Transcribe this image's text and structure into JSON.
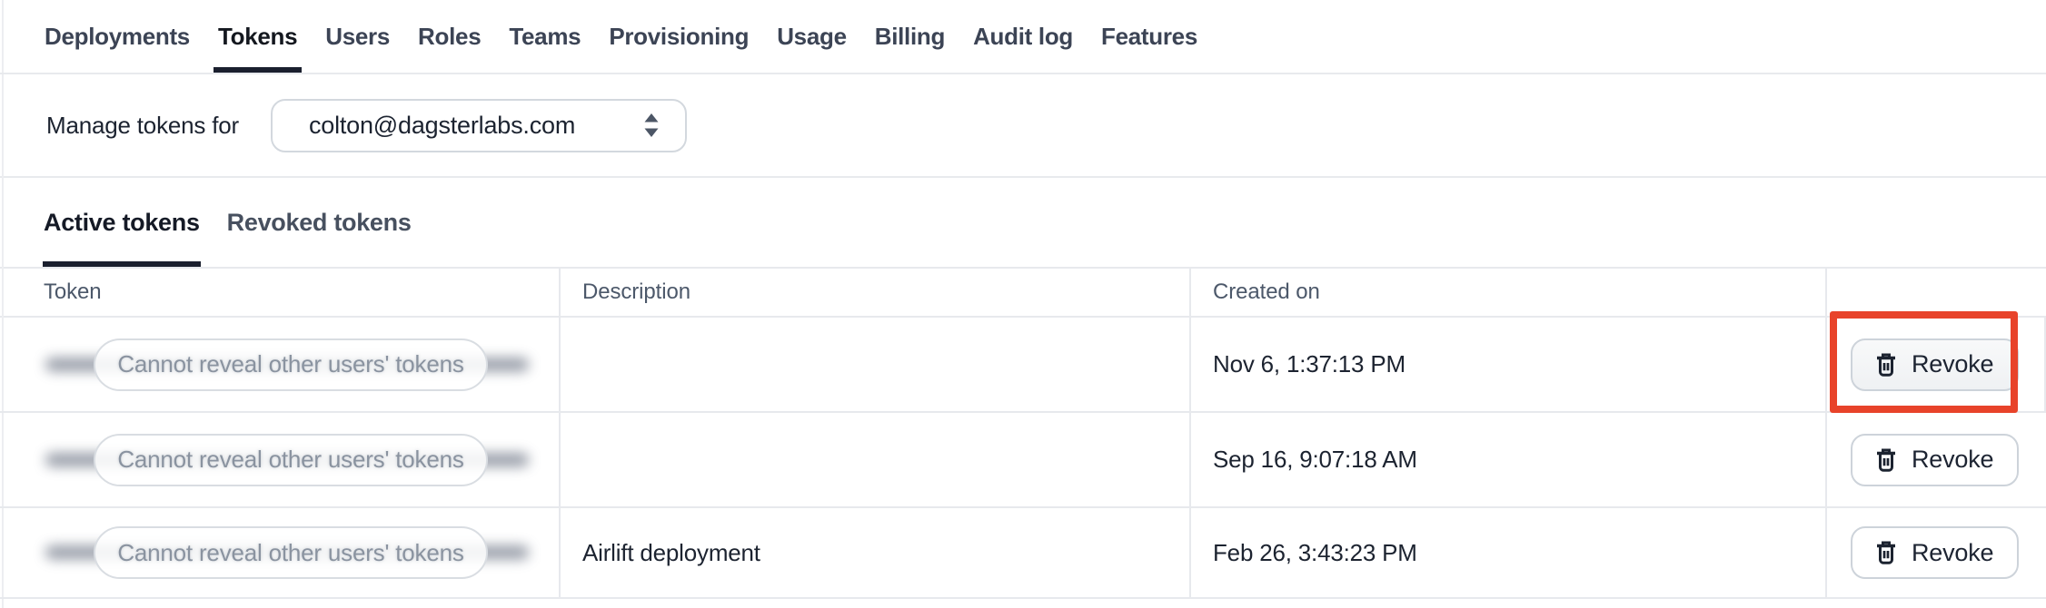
{
  "nav": {
    "tabs": [
      {
        "label": "Deployments",
        "selected": false
      },
      {
        "label": "Tokens",
        "selected": true
      },
      {
        "label": "Users",
        "selected": false
      },
      {
        "label": "Roles",
        "selected": false
      },
      {
        "label": "Teams",
        "selected": false
      },
      {
        "label": "Provisioning",
        "selected": false
      },
      {
        "label": "Usage",
        "selected": false
      },
      {
        "label": "Billing",
        "selected": false
      },
      {
        "label": "Audit log",
        "selected": false
      },
      {
        "label": "Features",
        "selected": false
      }
    ]
  },
  "manage": {
    "label": "Manage tokens for",
    "selected_user": "colton@dagsterlabs.com"
  },
  "token_tabs": {
    "active": "Active tokens",
    "revoked": "Revoked tokens"
  },
  "table": {
    "headers": {
      "token": "Token",
      "description": "Description",
      "created_on": "Created on"
    },
    "rows": [
      {
        "token_overlay": "Cannot reveal other users' tokens",
        "description": "",
        "created_on": "Nov 6, 1:37:13 PM",
        "action_label": "Revoke",
        "annotated": true
      },
      {
        "token_overlay": "Cannot reveal other users' tokens",
        "description": "",
        "created_on": "Sep 16, 9:07:18 AM",
        "action_label": "Revoke",
        "annotated": false
      },
      {
        "token_overlay": "Cannot reveal other users' tokens",
        "description": "Airlift deployment",
        "created_on": "Feb 26, 3:43:23 PM",
        "action_label": "Revoke",
        "annotated": false
      }
    ]
  },
  "icons": {
    "revoke_button": "trash-icon",
    "user_select": "double-caret-vertical-icon"
  },
  "colors": {
    "annotation_box": "#E8432A",
    "active_underline": "#1A1F2E",
    "text_dark": "#1C2330",
    "text_gray": "#4C586A",
    "border_light": "#E7E9ED"
  }
}
